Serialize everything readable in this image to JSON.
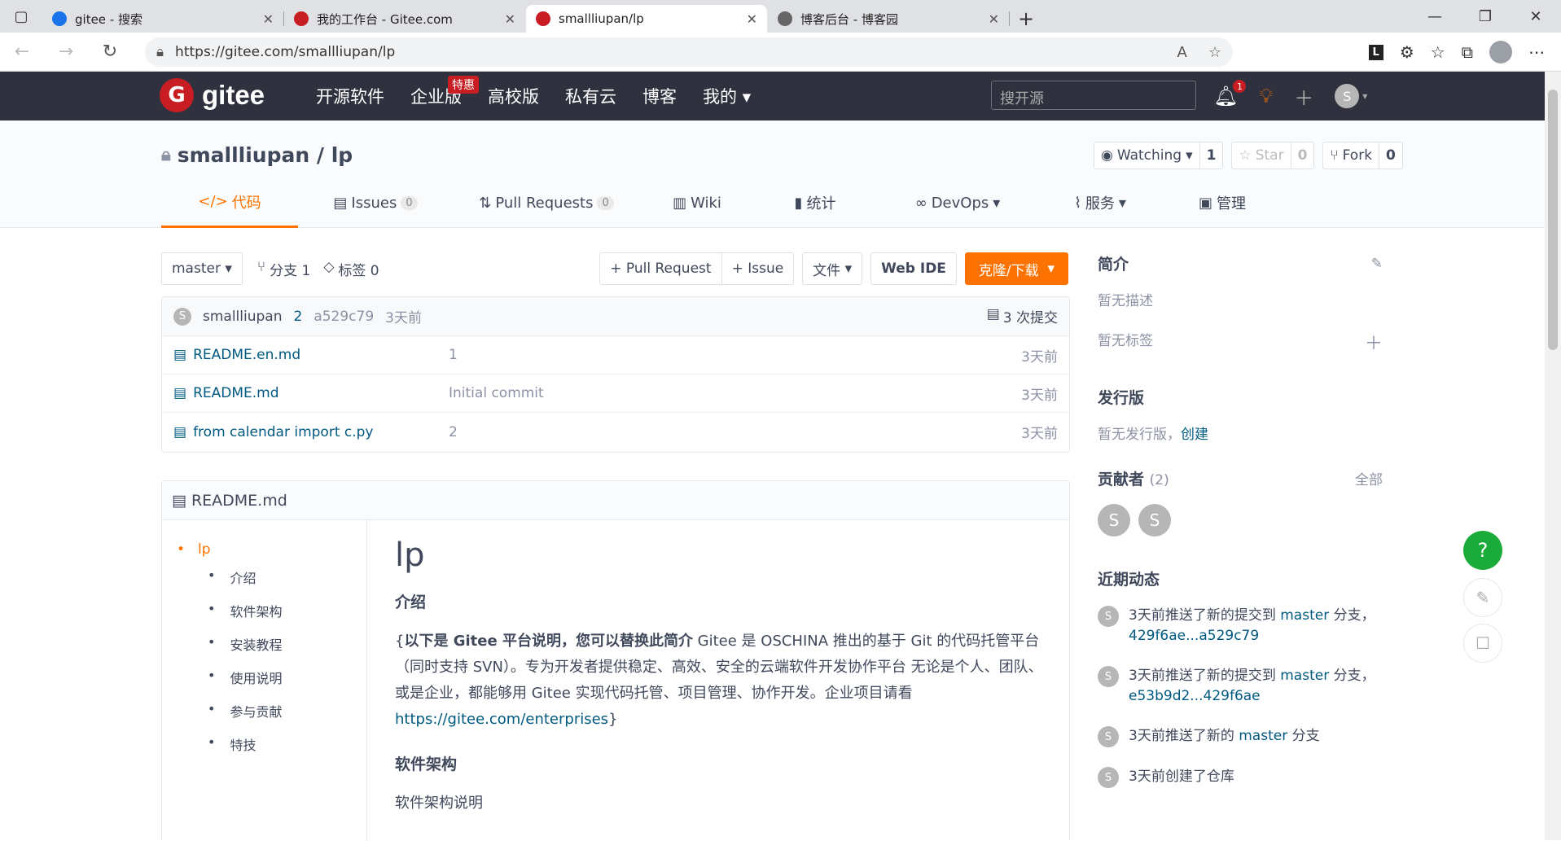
{
  "browser": {
    "tabs": [
      {
        "title": "gitee - 搜索",
        "fav": "#1a73e8"
      },
      {
        "title": "我的工作台 - Gitee.com",
        "fav": "#c71d23"
      },
      {
        "title": "smallliupan/lp",
        "fav": "#c71d23"
      },
      {
        "title": "博客后台 - 博客园",
        "fav": "#666666"
      }
    ],
    "url": "https://gitee.com/smallliupan/lp"
  },
  "gitee": {
    "logo": "gitee",
    "nav": [
      "开源软件",
      "企业版",
      "高校版",
      "私有云",
      "博客",
      "我的"
    ],
    "tehui": "特惠",
    "search_placeholder": "搜开源",
    "notif_count": "1",
    "avatar": "S"
  },
  "project": {
    "name": "smallliupan / lp",
    "watch_label": "Watching",
    "watch_count": "1",
    "star_label": "Star",
    "star_count": "0",
    "fork_label": "Fork",
    "fork_count": "0",
    "tabs": [
      {
        "label": "代码"
      },
      {
        "label": "Issues",
        "count": "0"
      },
      {
        "label": "Pull Requests",
        "count": "0"
      },
      {
        "label": "Wiki"
      },
      {
        "label": "统计"
      },
      {
        "label": "DevOps"
      },
      {
        "label": "服务"
      },
      {
        "label": "管理"
      }
    ]
  },
  "repo": {
    "branch": "master",
    "branches": "分支 1",
    "tags": "标签 0",
    "pr_btn": "+ Pull Request",
    "issue_btn": "+ Issue",
    "file_btn": "文件",
    "webide_btn": "Web IDE",
    "clone_btn": "克隆/下载",
    "commit": {
      "avatar": "S",
      "author": "smallliupan",
      "msg": "2",
      "hash": "a529c79",
      "time": "3天前",
      "count": "3 次提交"
    },
    "files": [
      {
        "name": "README.en.md",
        "msg": "1",
        "time": "3天前"
      },
      {
        "name": "README.md",
        "msg": "Initial commit",
        "time": "3天前"
      },
      {
        "name": "from calendar import c.py",
        "msg": "2",
        "time": "3天前"
      }
    ]
  },
  "readme": {
    "file": "README.md",
    "toc_top": "lp",
    "toc": [
      "介绍",
      "软件架构",
      "安装教程",
      "使用说明",
      "参与贡献",
      "特技"
    ],
    "h1": "lp",
    "intro_title": "介绍",
    "intro_brace_open": "{",
    "intro_bold": "以下是 Gitee 平台说明，您可以替换此简介",
    "intro_text": " Gitee 是 OSCHINA 推出的基于 Git 的代码托管平台（同时支持 SVN）。专为开发者提供稳定、高效、安全的云端软件开发协作平台 无论是个人、团队、或是企业，都能够用 Gitee 实现代码托管、项目管理、协作开发。企业项目请看 ",
    "intro_link": "https://gitee.com/enterprises",
    "intro_brace_close": "}",
    "arch_title": "软件架构",
    "arch_text": "软件架构说明"
  },
  "sidebar": {
    "intro_title": "简介",
    "no_desc": "暂无描述",
    "no_tags": "暂无标签",
    "release_title": "发行版",
    "no_release": "暂无发行版，",
    "create": "创建",
    "contrib_title": "贡献者",
    "contrib_count": "(2)",
    "all": "全部",
    "contributors": [
      "S",
      "S"
    ],
    "activity_title": "近期动态",
    "activities": [
      {
        "pre": "3天前推送了新的提交到 ",
        "branch": "master",
        "post": " 分支，",
        "link": "429f6ae...a529c79"
      },
      {
        "pre": "3天前推送了新的提交到 ",
        "branch": "master",
        "post": " 分支，",
        "link": "e53b9d2...429f6ae"
      },
      {
        "pre": "3天前推送了新的 ",
        "branch": "master",
        "post": " 分支",
        "link": ""
      },
      {
        "pre": "3天前创建了仓库",
        "branch": "",
        "post": "",
        "link": ""
      }
    ]
  },
  "colors": {
    "accent": "#fe7300",
    "header": "#2f323e",
    "link": "#005980",
    "help": "#1aab3a"
  }
}
